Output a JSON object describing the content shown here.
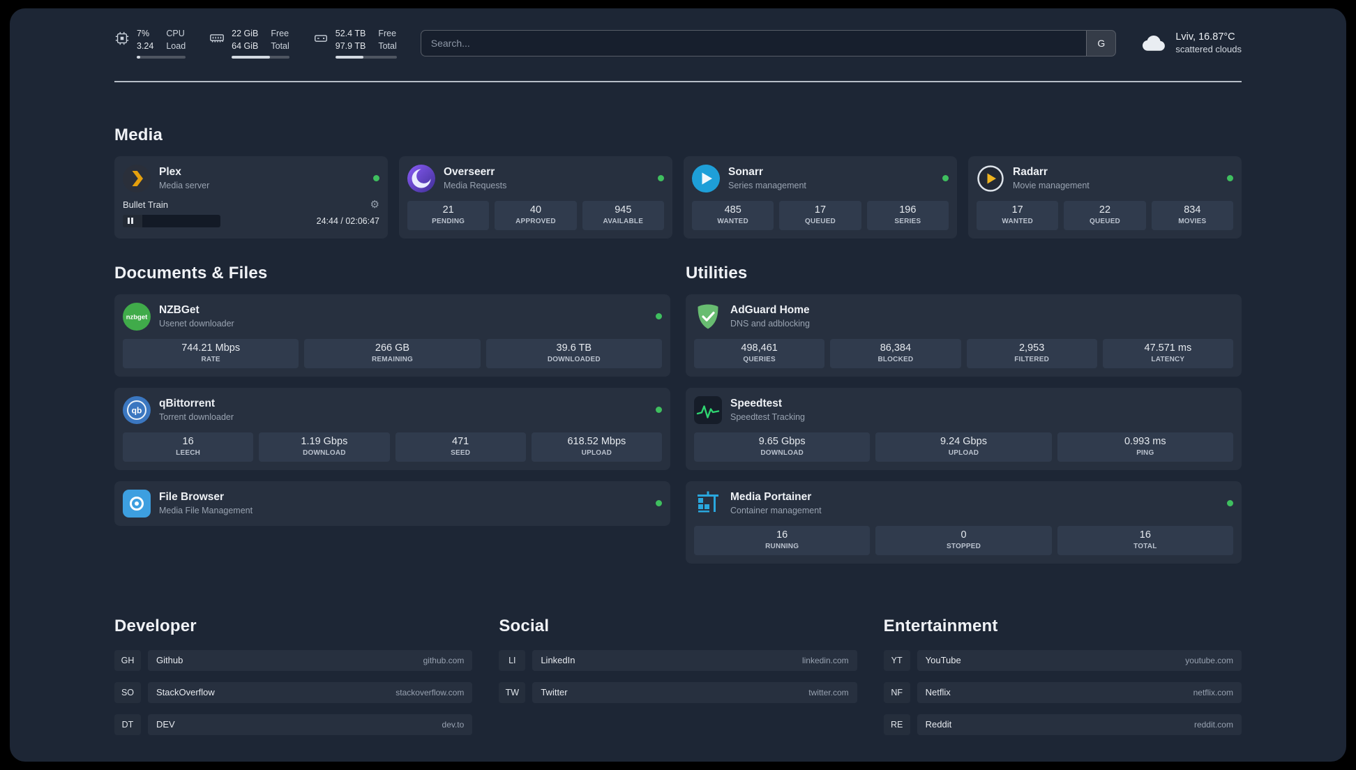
{
  "icons": {
    "gear": "⚙"
  },
  "colors": {
    "status_green": "#3fbf5f",
    "page_bg": "#1d2635"
  },
  "topbar": {
    "cpu": {
      "values": [
        "7%",
        "3.24"
      ],
      "labels": [
        "CPU",
        "Load"
      ],
      "percent": 7
    },
    "memory": {
      "values": [
        "22 GiB",
        "64 GiB"
      ],
      "labels": [
        "Free",
        "Total"
      ],
      "percent": 66
    },
    "disk": {
      "values": [
        "52.4 TB",
        "97.9 TB"
      ],
      "labels": [
        "Free",
        "Total"
      ],
      "percent": 46
    },
    "search": {
      "placeholder": "Search...",
      "provider": "G"
    },
    "weather": {
      "location": "Lviv, 16.87°C",
      "condition": "scattered clouds"
    }
  },
  "media": {
    "title": "Media",
    "plex": {
      "name": "Plex",
      "desc": "Media server",
      "track": "Bullet Train",
      "time": "24:44 / 02:06:47",
      "progress": 20
    },
    "overseerr": {
      "name": "Overseerr",
      "desc": "Media Requests",
      "stats": [
        {
          "value": "21",
          "label": "PENDING"
        },
        {
          "value": "40",
          "label": "APPROVED"
        },
        {
          "value": "945",
          "label": "AVAILABLE"
        }
      ]
    },
    "sonarr": {
      "name": "Sonarr",
      "desc": "Series management",
      "stats": [
        {
          "value": "485",
          "label": "WANTED"
        },
        {
          "value": "17",
          "label": "QUEUED"
        },
        {
          "value": "196",
          "label": "SERIES"
        }
      ]
    },
    "radarr": {
      "name": "Radarr",
      "desc": "Movie management",
      "stats": [
        {
          "value": "17",
          "label": "WANTED"
        },
        {
          "value": "22",
          "label": "QUEUED"
        },
        {
          "value": "834",
          "label": "MOVIES"
        }
      ]
    }
  },
  "documents": {
    "title": "Documents & Files",
    "nzbget": {
      "name": "NZBGet",
      "desc": "Usenet downloader",
      "stats": [
        {
          "value": "744.21 Mbps",
          "label": "RATE"
        },
        {
          "value": "266 GB",
          "label": "REMAINING"
        },
        {
          "value": "39.6 TB",
          "label": "DOWNLOADED"
        }
      ]
    },
    "qbittorrent": {
      "name": "qBittorrent",
      "desc": "Torrent downloader",
      "stats": [
        {
          "value": "16",
          "label": "LEECH"
        },
        {
          "value": "1.19 Gbps",
          "label": "DOWNLOAD"
        },
        {
          "value": "471",
          "label": "SEED"
        },
        {
          "value": "618.52 Mbps",
          "label": "UPLOAD"
        }
      ]
    },
    "filebrowser": {
      "name": "File Browser",
      "desc": "Media File Management"
    }
  },
  "utilities": {
    "title": "Utilities",
    "adguard": {
      "name": "AdGuard Home",
      "desc": "DNS and adblocking",
      "stats": [
        {
          "value": "498,461",
          "label": "QUERIES"
        },
        {
          "value": "86,384",
          "label": "BLOCKED"
        },
        {
          "value": "2,953",
          "label": "FILTERED"
        },
        {
          "value": "47.571 ms",
          "label": "LATENCY"
        }
      ]
    },
    "speedtest": {
      "name": "Speedtest",
      "desc": "Speedtest Tracking",
      "stats": [
        {
          "value": "9.65 Gbps",
          "label": "DOWNLOAD"
        },
        {
          "value": "9.24 Gbps",
          "label": "UPLOAD"
        },
        {
          "value": "0.993 ms",
          "label": "PING"
        }
      ]
    },
    "portainer": {
      "name": "Media Portainer",
      "desc": "Container management",
      "stats": [
        {
          "value": "16",
          "label": "RUNNING"
        },
        {
          "value": "0",
          "label": "STOPPED"
        },
        {
          "value": "16",
          "label": "TOTAL"
        }
      ]
    }
  },
  "bookmarks": {
    "developer": {
      "title": "Developer",
      "items": [
        {
          "abbr": "GH",
          "name": "Github",
          "url": "github.com"
        },
        {
          "abbr": "SO",
          "name": "StackOverflow",
          "url": "stackoverflow.com"
        },
        {
          "abbr": "DT",
          "name": "DEV",
          "url": "dev.to"
        }
      ]
    },
    "social": {
      "title": "Social",
      "items": [
        {
          "abbr": "LI",
          "name": "LinkedIn",
          "url": "linkedin.com"
        },
        {
          "abbr": "TW",
          "name": "Twitter",
          "url": "twitter.com"
        }
      ]
    },
    "entertainment": {
      "title": "Entertainment",
      "items": [
        {
          "abbr": "YT",
          "name": "YouTube",
          "url": "youtube.com"
        },
        {
          "abbr": "NF",
          "name": "Netflix",
          "url": "netflix.com"
        },
        {
          "abbr": "RE",
          "name": "Reddit",
          "url": "reddit.com"
        }
      ]
    }
  }
}
